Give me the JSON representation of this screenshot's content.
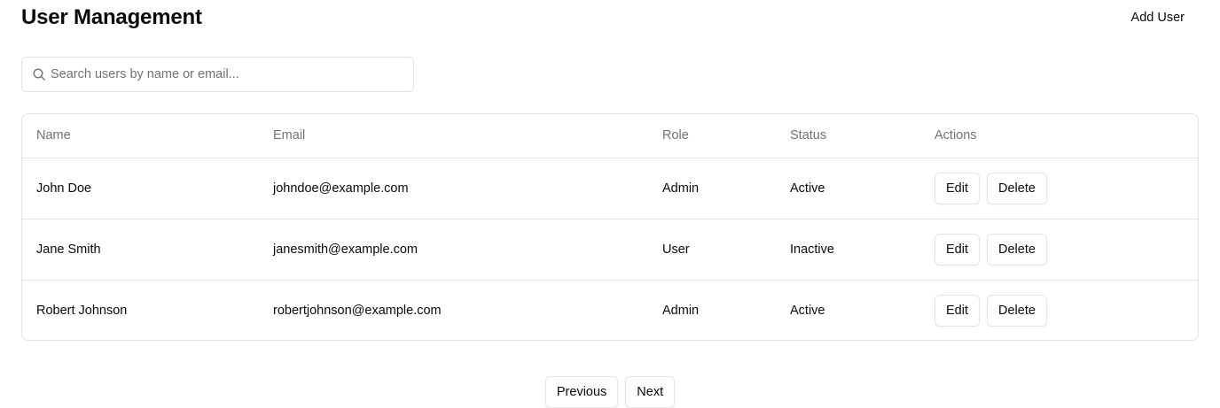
{
  "header": {
    "title": "User Management",
    "add_user_label": "Add User"
  },
  "search": {
    "placeholder": "Search users by name or email...",
    "value": "",
    "icon": "search-icon"
  },
  "table": {
    "columns": {
      "name": "Name",
      "email": "Email",
      "role": "Role",
      "status": "Status",
      "actions": "Actions"
    },
    "rows": [
      {
        "name": "John Doe",
        "email": "johndoe@example.com",
        "role": "Admin",
        "status": "Active",
        "edit_label": "Edit",
        "delete_label": "Delete"
      },
      {
        "name": "Jane Smith",
        "email": "janesmith@example.com",
        "role": "User",
        "status": "Inactive",
        "edit_label": "Edit",
        "delete_label": "Delete"
      },
      {
        "name": "Robert Johnson",
        "email": "robertjohnson@example.com",
        "role": "Admin",
        "status": "Active",
        "edit_label": "Edit",
        "delete_label": "Delete"
      }
    ]
  },
  "pagination": {
    "previous_label": "Previous",
    "next_label": "Next"
  },
  "colors": {
    "text": "#0a0a0a",
    "muted": "#71717a",
    "border": "#e4e4e7",
    "background": "#ffffff"
  }
}
